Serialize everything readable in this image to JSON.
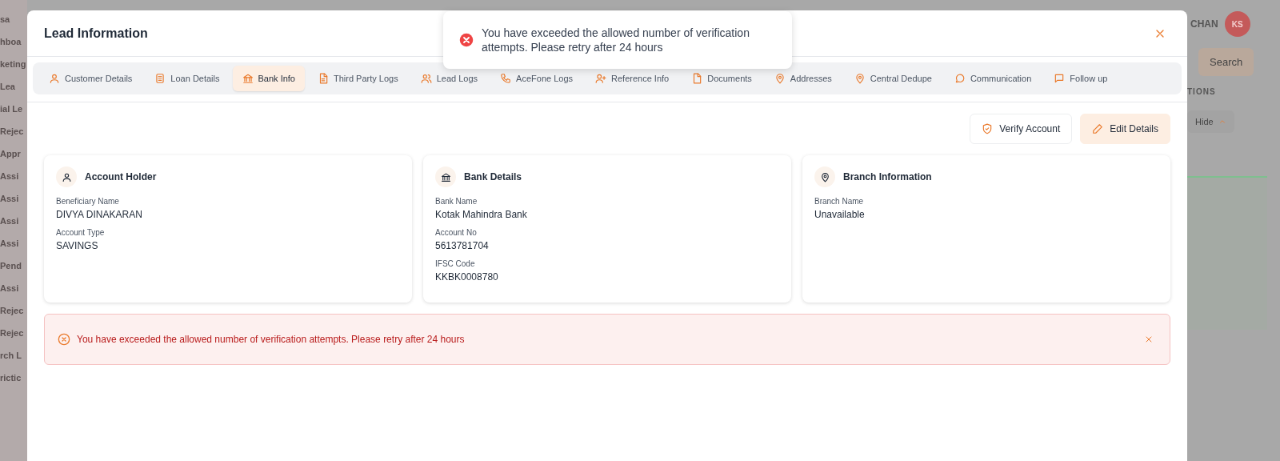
{
  "background": {
    "sidebar_items": [
      "sa",
      "hboa",
      "keting",
      "Lea",
      "ial Le",
      "Rejec",
      "Appr",
      "Assi",
      "Assi",
      "Assi",
      "Assi",
      "Pend",
      "Assi",
      "Rejec",
      "Rejec",
      "rch L",
      "rictic"
    ],
    "user_name": "CHAN",
    "avatar_initials": "KS",
    "search_button": "Search",
    "column_heading": "TIONS",
    "hide_button": "Hide"
  },
  "modal": {
    "title": "Lead Information",
    "tabs": [
      {
        "label": "Customer Details",
        "selected": false
      },
      {
        "label": "Loan Details",
        "selected": false
      },
      {
        "label": "Bank Info",
        "selected": true
      },
      {
        "label": "Third Party Logs",
        "selected": false
      },
      {
        "label": "Lead Logs",
        "selected": false
      },
      {
        "label": "AceFone Logs",
        "selected": false
      },
      {
        "label": "Reference Info",
        "selected": false
      },
      {
        "label": "Documents",
        "selected": false
      },
      {
        "label": "Addresses",
        "selected": false
      },
      {
        "label": "Central Dedupe",
        "selected": false
      },
      {
        "label": "Communication",
        "selected": false
      },
      {
        "label": "Follow up",
        "selected": false
      }
    ],
    "actions": [
      {
        "label": "Verify Account",
        "kind": "outline"
      },
      {
        "label": "Edit Details",
        "kind": "tinted"
      }
    ],
    "cards": [
      {
        "title": "Account Holder",
        "fields": [
          {
            "label": "Beneficiary Name",
            "value": "DIVYA DINAKARAN"
          },
          {
            "label": "Account Type",
            "value": "SAVINGS"
          }
        ]
      },
      {
        "title": "Bank Details",
        "fields": [
          {
            "label": "Bank Name",
            "value": "Kotak Mahindra Bank"
          },
          {
            "label": "Account No",
            "value": "5613781704"
          },
          {
            "label": "IFSC Code",
            "value": "KKBK0008780"
          }
        ]
      },
      {
        "title": "Branch Information",
        "fields": [
          {
            "label": "Branch Name",
            "value": "Unavailable"
          }
        ]
      }
    ],
    "alert": {
      "message": "You have exceeded the allowed number of verification attempts. Please retry after 24 hours"
    }
  },
  "toast": {
    "message": "You have exceeded the allowed number of verification attempts. Please retry after 24 hours"
  }
}
